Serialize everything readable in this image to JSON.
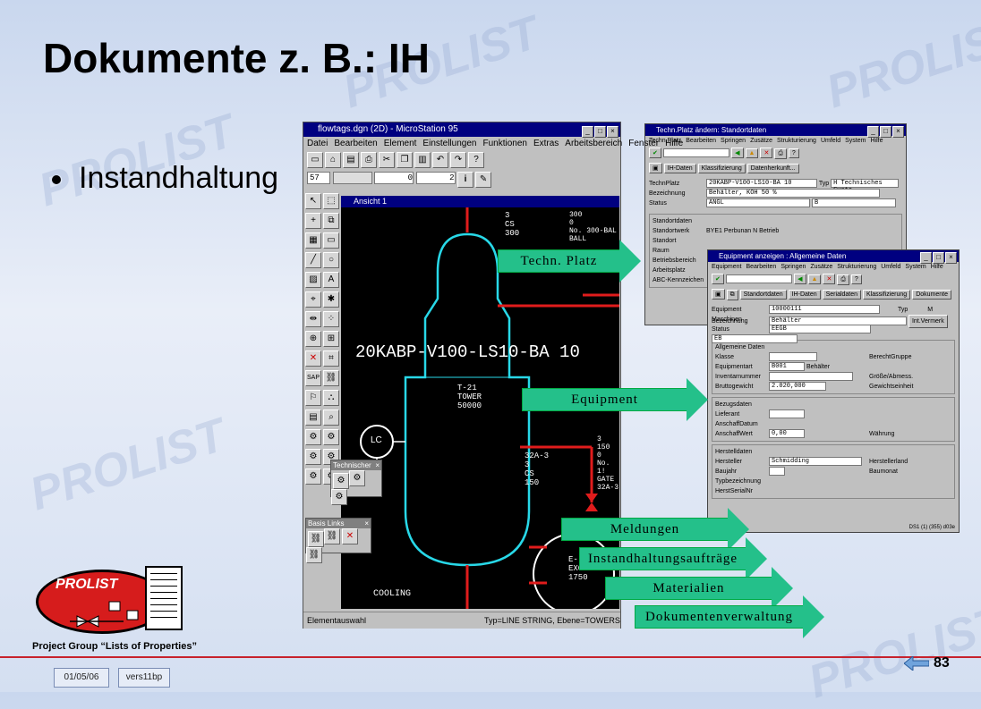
{
  "slide": {
    "title": "Dokumente z. B.: IH",
    "bullet": "Instandhaltung",
    "watermark": "PROLIST",
    "page_number": "83",
    "date": "01/05/06",
    "version": "vers11bp",
    "logo_text": "PROLIST",
    "caption": "Project Group “Lists of Properties”"
  },
  "microstation": {
    "title": "flowtags.dgn (2D) - MicroStation 95",
    "menu": [
      "Datei",
      "Bearbeiten",
      "Element",
      "Einstellungen",
      "Funktionen",
      "Extras",
      "Arbeitsbereich",
      "Fenster",
      "Hilfe"
    ],
    "level_value": "57",
    "weight_value": "0",
    "style_value": "2",
    "view_title": "Ansicht 1",
    "drawing_tag": "20KABP-V100-LS10-BA 10",
    "tower_label": "T-21",
    "tower_name": "TOWER",
    "tower_size": "50000",
    "lc_label": "LC",
    "top_labels": [
      "3",
      "CS",
      "300",
      "300",
      "0",
      "No. 300-BAL",
      "BALL"
    ],
    "side_labels": [
      "32A-3",
      "3",
      "CS",
      "150"
    ],
    "right_labels": [
      "3",
      "150",
      "0",
      "No. 1!",
      "GATE",
      "32A-3"
    ],
    "exchanger": [
      "E-",
      "EXCHANGE",
      "1750"
    ],
    "cooling": "COOLING",
    "palette_technischer": "Technischer",
    "palette_basis": "Basis Links",
    "status_left": "Elementauswahl",
    "status_right": "Typ=LINE STRING, Ebene=TOWERS"
  },
  "sap_techplatz": {
    "title": "Techn.Platz ändern: Standortdaten",
    "menu": [
      "Techn.Platz",
      "Bearbeiten",
      "Springen",
      "Zusätze",
      "Strukturierung",
      "Umfeld",
      "System",
      "Hilfe"
    ],
    "buttons": [
      "IH-Daten",
      "Klassifizierung",
      "Datenherkunft..."
    ],
    "techplatz_label": "TechnPlatz",
    "techplatz_value": "20KABP-V100-LS10-BA 10",
    "typ_label": "Typ",
    "typ_value": "H Technisches Syste",
    "bez_label": "Bezeichnung",
    "bez_value": "Behälter, KOH 50 %",
    "status_label": "Status",
    "status_value": "ANGL",
    "status_value2": "B",
    "section": "Standortdaten",
    "fields": [
      "Standortwerk",
      "Standort",
      "Raum",
      "Betriebsbereich",
      "Arbeitsplatz",
      "ABC-Kennzeichen"
    ],
    "werk_value": "BYE1 Perbunan N Betrieb"
  },
  "sap_equipment": {
    "title": "Equipment anzeigen : Allgemeine Daten",
    "menu": [
      "Equipment",
      "Bearbeiten",
      "Springen",
      "Zusätze",
      "Strukturierung",
      "Umfeld",
      "System",
      "Hilfe"
    ],
    "buttons": [
      "Standortdaten",
      "IH-Daten",
      "Serialdaten",
      "Klassifizierung",
      "Dokumente"
    ],
    "equipment_label": "Equipment",
    "equipment_value": "10000111",
    "typ_label": "Typ",
    "typ_value": "M Maschinen",
    "bez_label": "Bezeichnung",
    "bez_value": "Behälter",
    "vermerk": "Int.Vermerk",
    "status_label": "Status",
    "status_value": "EEGB",
    "status_value2": "EB",
    "group1": "Allgemeine Daten",
    "klasse": "Klasse",
    "berecht": "BerechtGruppe",
    "equipmentart": "Equipmentart",
    "equipmentart_value": "B001",
    "equipmentart_text": "Behälter",
    "inventar": "Inventarnummer",
    "groesse": "Größe/Abmess.",
    "brutto": "Bruttogewicht",
    "brutto_value": "2.020,000",
    "gewichts": "Gewichtseinheit",
    "group2": "Bezugsdaten",
    "lieferant": "Lieferant",
    "anschaffdatum": "AnschaffDatum",
    "anschaffwert": "AnschaffWert",
    "anschaffwert_value": "0,00",
    "waehrung": "Währung",
    "group3": "Herstelldaten",
    "hersteller": "Hersteller",
    "hersteller_value": "Schmidding",
    "herstellerland": "Herstellerland",
    "baujahr": "Baujahr",
    "baumonat": "Baumonat",
    "typbez": "Typbezeichnung",
    "serialnr": "HerstSerialNr",
    "status_code": "DS1 (1) (355)",
    "status_code2": "d03e"
  },
  "arrows": [
    "Techn. Platz",
    "Equipment",
    "Meldungen",
    "Instandhaltungsaufträge",
    "Materialien",
    "Dokumentenverwaltung"
  ],
  "colors": {
    "arrow": "#24c08a",
    "logo_red": "#d61c1c",
    "sap_title": "#000080",
    "footer_line": "#c7222d"
  }
}
